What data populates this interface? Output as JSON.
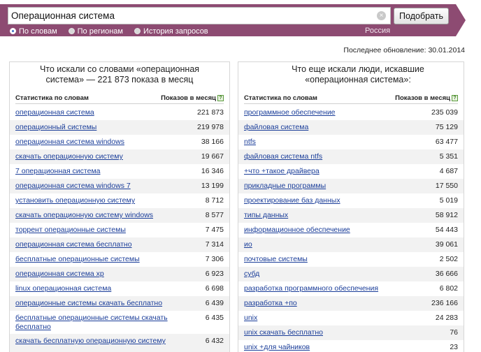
{
  "search": {
    "query": "Операционная система",
    "submit_label": "Подобрать",
    "clear_glyph": "×"
  },
  "tabs": [
    {
      "label": "По словам",
      "selected": true
    },
    {
      "label": "По регионам",
      "selected": false
    },
    {
      "label": "История запросов",
      "selected": false
    }
  ],
  "region": "Россия",
  "last_update": "Последнее обновление: 30.01.2014",
  "left_panel": {
    "title": "Что искали со словами «операционная система» — 221 873 показа в месяц",
    "col_left": "Статистика по словам",
    "col_right": "Показов в месяц",
    "help_glyph": "?",
    "rows": [
      {
        "phrase": "операционная система",
        "count": "221 873"
      },
      {
        "phrase": "операционный системы",
        "count": "219 978"
      },
      {
        "phrase": "операционная система windows",
        "count": "38 166"
      },
      {
        "phrase": "скачать операционную систему",
        "count": "19 667"
      },
      {
        "phrase": "7 операционная система",
        "count": "16 346"
      },
      {
        "phrase": "операционная система windows 7",
        "count": "13 199"
      },
      {
        "phrase": "установить операционную систему",
        "count": "8 712"
      },
      {
        "phrase": "скачать операционную систему windows",
        "count": "8 577"
      },
      {
        "phrase": "торрент операционные системы",
        "count": "7 475"
      },
      {
        "phrase": "операционная система бесплатно",
        "count": "7 314"
      },
      {
        "phrase": "бесплатные операционные системы",
        "count": "7 306"
      },
      {
        "phrase": "операционная система xp",
        "count": "6 923"
      },
      {
        "phrase": "linux операционная система",
        "count": "6 698"
      },
      {
        "phrase": "операционные системы скачать бесплатно",
        "count": "6 439"
      },
      {
        "phrase": "бесплатные операционные системы скачать бесплатно",
        "count": "6 435"
      },
      {
        "phrase": "скачать бесплатную операционную систему",
        "count": "6 432"
      }
    ]
  },
  "right_panel": {
    "title": "Что еще искали люди, искавшие «операционная система»:",
    "col_left": "Статистика по словам",
    "col_right": "Показов в месяц",
    "help_glyph": "?",
    "rows": [
      {
        "phrase": "программное обеспечение",
        "count": "235 039"
      },
      {
        "phrase": "файловая система",
        "count": "75 129"
      },
      {
        "phrase": "ntfs",
        "count": "63 477"
      },
      {
        "phrase": "файловая система ntfs",
        "count": "5 351"
      },
      {
        "phrase": "+что +такое драйвера",
        "count": "4 687"
      },
      {
        "phrase": "прикладные программы",
        "count": "17 550"
      },
      {
        "phrase": "проектирование баз данных",
        "count": "5 019"
      },
      {
        "phrase": "типы данных",
        "count": "58 912"
      },
      {
        "phrase": "информационное обеспечение",
        "count": "54 443"
      },
      {
        "phrase": "ио",
        "count": "39 061"
      },
      {
        "phrase": "почтовые системы",
        "count": "2 502"
      },
      {
        "phrase": "субд",
        "count": "36 666"
      },
      {
        "phrase": "разработка программного обеспечения",
        "count": "6 802"
      },
      {
        "phrase": "разработка +по",
        "count": "236 166"
      },
      {
        "phrase": "unix",
        "count": "24 283"
      },
      {
        "phrase": "unix скачать бесплатно",
        "count": "76"
      },
      {
        "phrase": "unix +для чайников",
        "count": "23"
      }
    ]
  },
  "colors": {
    "band": "#8d4b72",
    "link": "#1a3d99",
    "alt_row": "#f2f2f2"
  }
}
